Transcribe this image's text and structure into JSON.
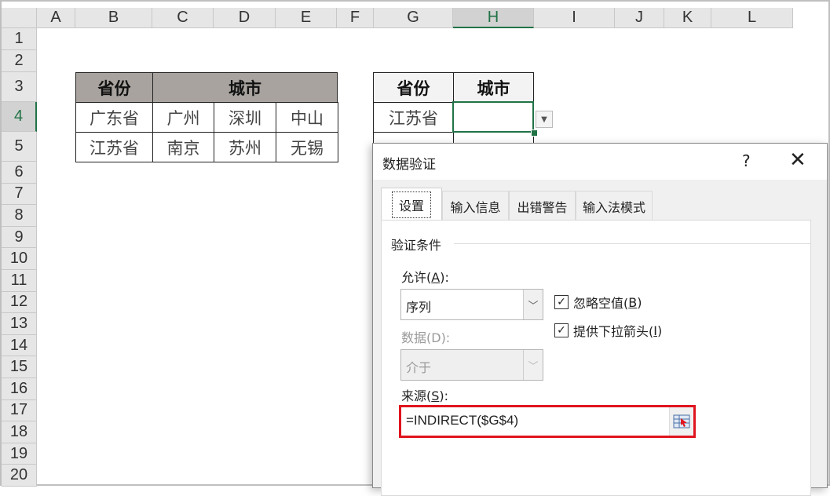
{
  "sheet": {
    "columns": [
      "A",
      "B",
      "C",
      "D",
      "E",
      "F",
      "G",
      "H",
      "I",
      "J",
      "K",
      "L"
    ],
    "rows": [
      "1",
      "2",
      "3",
      "4",
      "5",
      "6",
      "7",
      "8",
      "9",
      "10",
      "11",
      "12",
      "13",
      "14",
      "15",
      "16",
      "17",
      "18",
      "19",
      "20"
    ],
    "selected_column": "H",
    "selected_row": "4",
    "table1": {
      "header_province": "省份",
      "header_city": "城市",
      "rows": [
        {
          "province": "广东省",
          "cities": [
            "广州",
            "深圳",
            "中山"
          ]
        },
        {
          "province": "江苏省",
          "cities": [
            "南京",
            "苏州",
            "无锡"
          ]
        }
      ]
    },
    "table2": {
      "header_province": "省份",
      "header_city": "城市",
      "province_value": "江苏省",
      "city_value": ""
    }
  },
  "dialog": {
    "title": "数据验证",
    "help": "?",
    "close": "✕",
    "tabs": [
      {
        "label": "设置",
        "active": true
      },
      {
        "label": "输入信息",
        "active": false
      },
      {
        "label": "出错警告",
        "active": false
      },
      {
        "label": "输入法模式",
        "active": false
      }
    ],
    "group_title": "验证条件",
    "allow_label": "允许(",
    "allow_key": "A",
    "allow_suffix": "):",
    "allow_value": "序列",
    "data_label": "数据(D):",
    "data_value": "介于",
    "ignore_blank_label": "忽略空值(",
    "ignore_blank_key": "B",
    "ignore_blank_checked": true,
    "dropdown_label": "提供下拉箭头(",
    "dropdown_key": "I",
    "dropdown_checked": true,
    "paren_close": ")",
    "source_label": "来源(",
    "source_key": "S",
    "source_suffix": "):",
    "source_value": "=INDIRECT($G$4)",
    "highlight_color": "#e0141e"
  }
}
